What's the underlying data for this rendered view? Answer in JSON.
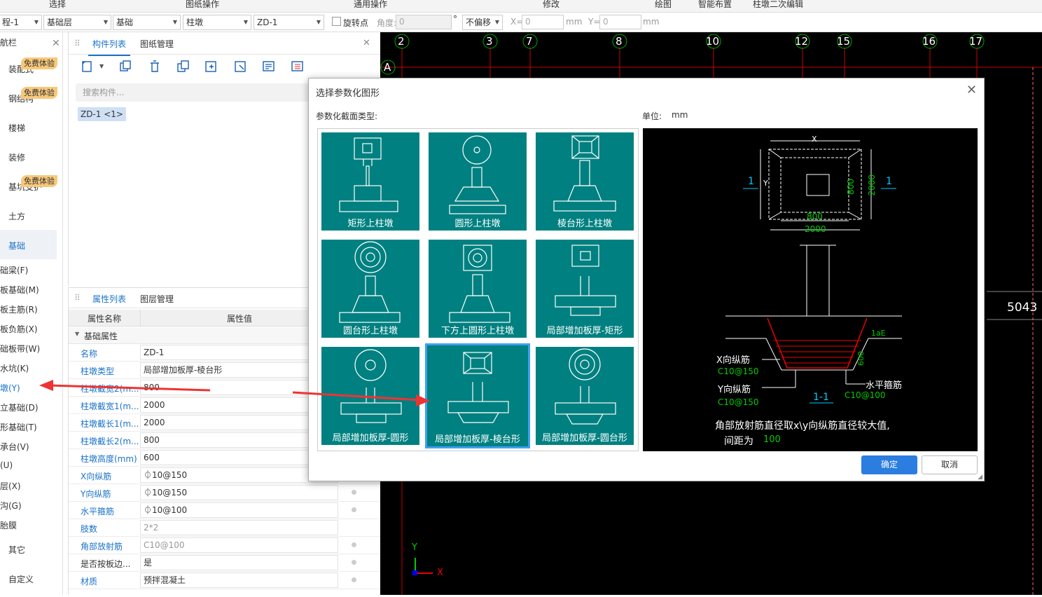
{
  "ribbon": {
    "items": [
      "选择",
      "图纸操作",
      "通用操作",
      "修改",
      "绘图",
      "智能布置",
      "柱墩二次编辑"
    ]
  },
  "toolbar": {
    "project": "程-1",
    "layer": "基础层",
    "category": "基础",
    "type": "柱墩",
    "element": "ZD-1",
    "rotate_label": "旋转点",
    "angle_label": "角度:",
    "angle_value": "0",
    "degree": "°",
    "offset": "不偏移",
    "x_label": "X=",
    "x_value": "0",
    "y_label": "Y=",
    "y_value": "0",
    "unit": "mm"
  },
  "nav": {
    "title": "航栏",
    "badge": "免费体验",
    "items": [
      "装配式",
      "钢结构",
      "楼梯",
      "装修",
      "基坑支护",
      "土方",
      "基础",
      "其它",
      "自定义"
    ],
    "subitems": [
      "础梁(F)",
      "板基础(M)",
      "板主筋(R)",
      "板负筋(X)",
      "础板带(W)",
      "水坑(K)",
      "墩(Y)",
      "立基础(D)",
      "形基础(T)",
      "承台(V)",
      "(U)",
      "层(X)",
      "沟(G)",
      "胎膜"
    ]
  },
  "component_panel": {
    "tabs": [
      "构件列表",
      "图纸管理"
    ],
    "search_placeholder": "搜索构件...",
    "item": "ZD-1 <1>"
  },
  "property_panel": {
    "tabs": [
      "属性列表",
      "图层管理"
    ],
    "col_name": "属性名称",
    "col_value": "属性值",
    "group": "基础属性",
    "rows": [
      {
        "k": "名称",
        "v": "ZD-1"
      },
      {
        "k": "柱墩类型",
        "v": "局部增加板厚-棱台形"
      },
      {
        "k": "柱墩截宽2(m...",
        "v": "800"
      },
      {
        "k": "柱墩截宽1(m...",
        "v": "2000"
      },
      {
        "k": "柱墩截长1(m...",
        "v": "2000"
      },
      {
        "k": "柱墩截长2(m...",
        "v": "800"
      },
      {
        "k": "柱墩高度(mm)",
        "v": "600"
      },
      {
        "k": "X向纵筋",
        "v": "⏀10@150"
      },
      {
        "k": "Y向纵筋",
        "v": "⏀10@150"
      },
      {
        "k": "水平箍筋",
        "v": "⏀10@100"
      },
      {
        "k": "肢数",
        "v": "2*2"
      },
      {
        "k": "角部放射筋",
        "v": "C10@100"
      },
      {
        "k": "是否按板边...",
        "v": "是"
      },
      {
        "k": "材质",
        "v": "预拌混凝土"
      }
    ]
  },
  "canvas": {
    "axis_labels": [
      "2",
      "3",
      "7",
      "8",
      "10",
      "12",
      "15",
      "16",
      "17"
    ],
    "row_label": "A",
    "dimension": "5043",
    "y_axis": "Y",
    "x_axis": "X"
  },
  "dialog": {
    "title": "选择参数化图形",
    "section_label": "参数化截面类型:",
    "unit_label": "单位:",
    "unit": "mm",
    "shapes": [
      "矩形上柱墩",
      "圆形上柱墩",
      "棱台形上柱墩",
      "圆台形上柱墩",
      "下方上圆形上柱墩",
      "局部增加板厚-矩形",
      "局部增加板厚-圆形",
      "局部增加板厚-棱台形",
      "局部增加板厚-圆台形"
    ],
    "selected_index": 7,
    "preview": {
      "plan_x": "X",
      "plan_y": "Y",
      "dim_800a": "800",
      "dim_2000a": "2000",
      "dim_800b": "800",
      "dim_2000b": "2000",
      "sec_mark": "1",
      "lae": "1aE",
      "h600": "600",
      "x_bar": "X向纵筋",
      "x_bar_val": "C10@150",
      "y_bar": "Y向纵筋",
      "y_bar_val": "C10@150",
      "h_bar": "水平箍筋",
      "h_bar_val": "C10@100",
      "section": "1-1",
      "note1": "角部放射筋直径取x\\y向纵筋直径较大值,",
      "note2": "间距为",
      "note2_val": "100"
    },
    "ok": "确定",
    "cancel": "取消"
  }
}
